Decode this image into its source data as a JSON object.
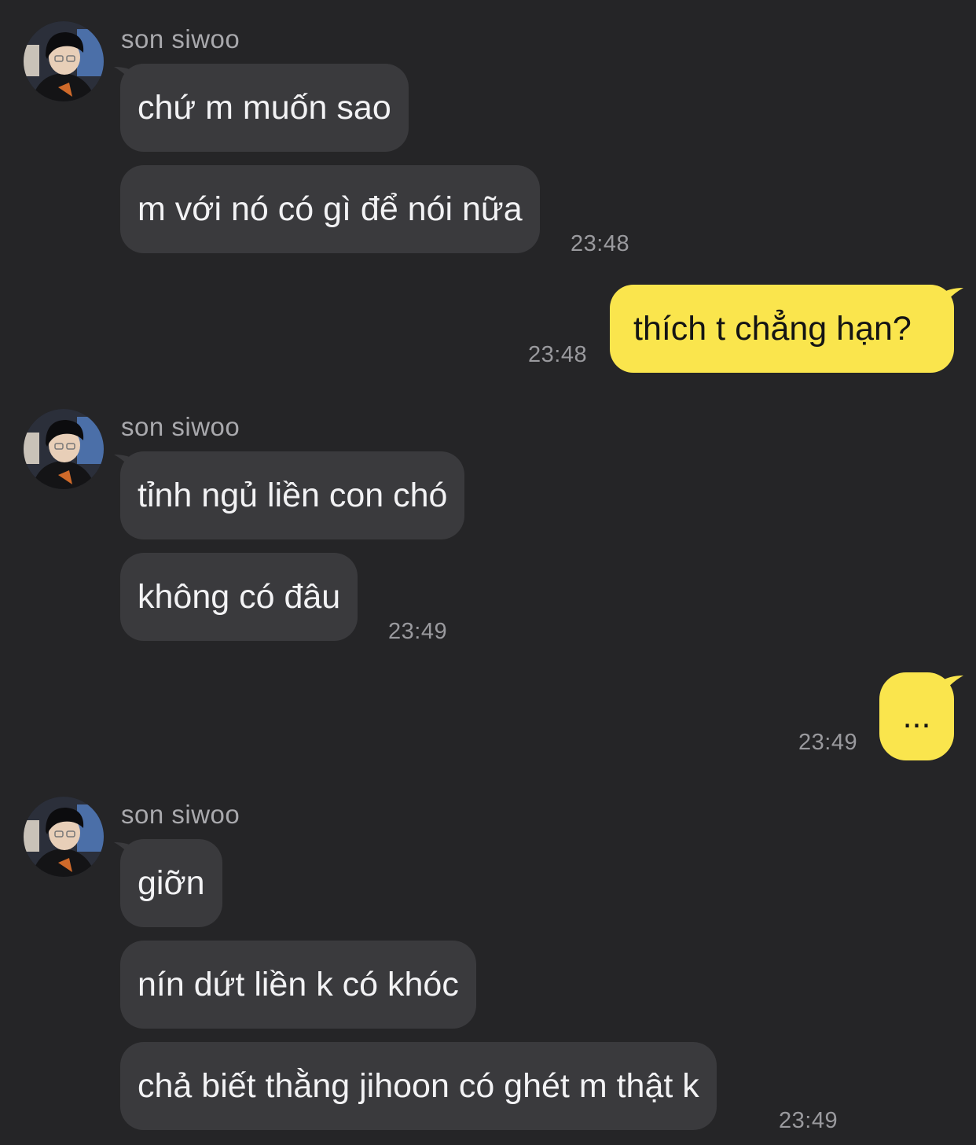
{
  "sender": {
    "name": "son siwoo"
  },
  "groups": [
    {
      "messages": [
        "chứ m muốn sao",
        "m với nó có gì để nói nữa"
      ],
      "time": "23:48"
    },
    {
      "messages": [
        "tỉnh ngủ liền con chó",
        "không có đâu"
      ],
      "time": "23:49"
    },
    {
      "messages": [
        "giỡn",
        "nín dứt liền k có khóc",
        "chả biết thằng jihoon có ghét m thật k"
      ],
      "time": "23:49"
    }
  ],
  "outgoing": [
    {
      "text": "thích t chẳng hạn?",
      "time": "23:48"
    },
    {
      "text": "...",
      "time": "23:49"
    }
  ],
  "colors": {
    "background": "#252527",
    "incoming_bubble": "#3a3a3d",
    "outgoing_bubble": "#fae54d"
  }
}
